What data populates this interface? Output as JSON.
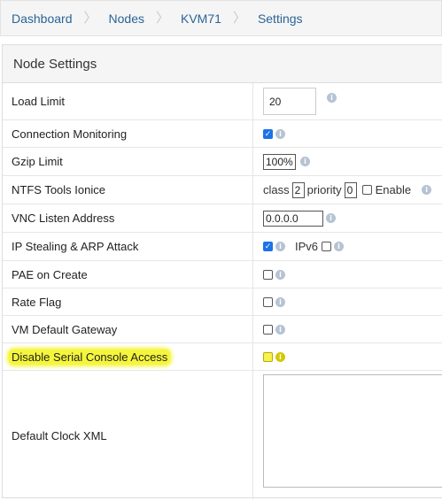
{
  "breadcrumb": [
    "Dashboard",
    "Nodes",
    "KVM71",
    "Settings"
  ],
  "panel": {
    "title": "Node Settings"
  },
  "rows": {
    "load_limit": {
      "label": "Load Limit",
      "value": "20"
    },
    "connection_monitoring": {
      "label": "Connection Monitoring",
      "checked": true
    },
    "gzip_limit": {
      "label": "Gzip Limit",
      "value": "100%"
    },
    "ntfs_tools_ionice": {
      "label": "NTFS Tools Ionice",
      "class_label": "class",
      "class_value": "2",
      "priority_label": "priority",
      "priority_value": "0",
      "enable_label": "Enable",
      "enable_checked": false
    },
    "vnc_listen_address": {
      "label": "VNC Listen Address",
      "value": "0.0.0.0"
    },
    "ip_stealing": {
      "label": "IP Stealing & ARP Attack",
      "checked": true,
      "ipv6_label": "IPv6",
      "ipv6_checked": false
    },
    "pae_on_create": {
      "label": "PAE on Create",
      "checked": false
    },
    "rate_flag": {
      "label": "Rate Flag",
      "checked": false
    },
    "vm_default_gateway": {
      "label": "VM Default Gateway",
      "checked": false
    },
    "disable_serial_console": {
      "label": "Disable Serial Console Access",
      "checked": false,
      "highlight_color": "#f5f53c"
    },
    "default_clock_xml": {
      "label": "Default Clock XML",
      "value": ""
    }
  },
  "icons": {
    "info": "info-icon",
    "checkmark": "✓"
  },
  "colors": {
    "link": "#2a6496",
    "checkbox_on": "#1a73e8",
    "highlight": "#f5f53c"
  }
}
